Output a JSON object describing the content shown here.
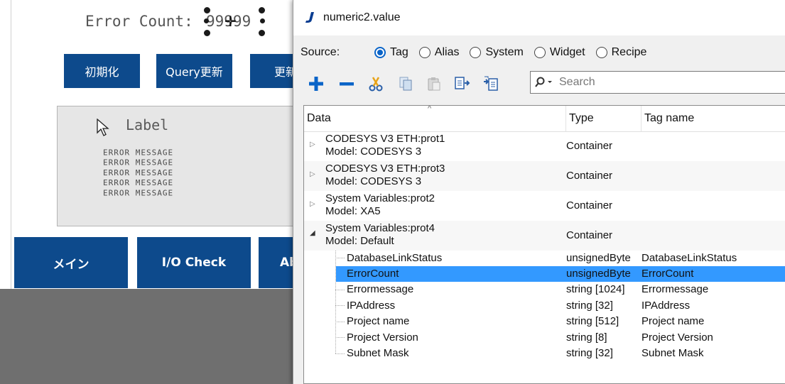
{
  "canvas": {
    "error_count_label": "Error Count:",
    "error_count_value": "99999",
    "buttons": [
      "初期化",
      "Query更新",
      "更新"
    ],
    "message_box": {
      "label": "Label",
      "lines": [
        "ERROR MESSAGE",
        "ERROR MESSAGE",
        "ERROR MESSAGE",
        "ERROR MESSAGE",
        "ERROR MESSAGE"
      ]
    },
    "nav": [
      "メイン",
      "I/O Check",
      "Ab"
    ]
  },
  "dialog": {
    "title": "numeric2.value",
    "source": {
      "label": "Source:",
      "options": [
        "Tag",
        "Alias",
        "System",
        "Widget",
        "Recipe"
      ],
      "selected": "Tag"
    },
    "toolbar": {
      "icons": [
        "add-icon",
        "remove-icon",
        "cut-icon",
        "copy-icon",
        "paste-icon",
        "import-icon",
        "export-icon"
      ],
      "search_placeholder": "Search"
    },
    "columns": [
      "Data",
      "Type",
      "Tag name"
    ],
    "containers": [
      {
        "line1": "CODESYS V3 ETH:prot1",
        "line2": "Model: CODESYS 3",
        "type": "Container",
        "expanded": false
      },
      {
        "line1": "CODESYS V3 ETH:prot3",
        "line2": "Model: CODESYS 3",
        "type": "Container",
        "expanded": false
      },
      {
        "line1": "System Variables:prot2",
        "line2": "Model: XA5",
        "type": "Container",
        "expanded": false
      },
      {
        "line1": "System Variables:prot4",
        "line2": "Model: Default",
        "type": "Container",
        "expanded": true
      }
    ],
    "children": [
      {
        "name": "DatabaseLinkStatus",
        "type": "unsignedByte",
        "tag": "DatabaseLinkStatus",
        "selected": false
      },
      {
        "name": "ErrorCount",
        "type": "unsignedByte",
        "tag": "ErrorCount",
        "selected": true
      },
      {
        "name": "Errormessage",
        "type": "string [1024]",
        "tag": "Errormessage",
        "selected": false
      },
      {
        "name": "IPAddress",
        "type": "string [32]",
        "tag": "IPAddress",
        "selected": false
      },
      {
        "name": "Project name",
        "type": "string [512]",
        "tag": "Project name",
        "selected": false
      },
      {
        "name": "Project Version",
        "type": "string [8]",
        "tag": "Project Version",
        "selected": false
      },
      {
        "name": "Subnet Mask",
        "type": "string [32]",
        "tag": "Subnet Mask",
        "selected": false
      }
    ],
    "colors": {
      "accent": "#0a64c8",
      "selection": "#3399ff",
      "hmi_blue": "#0d4a8c"
    }
  }
}
